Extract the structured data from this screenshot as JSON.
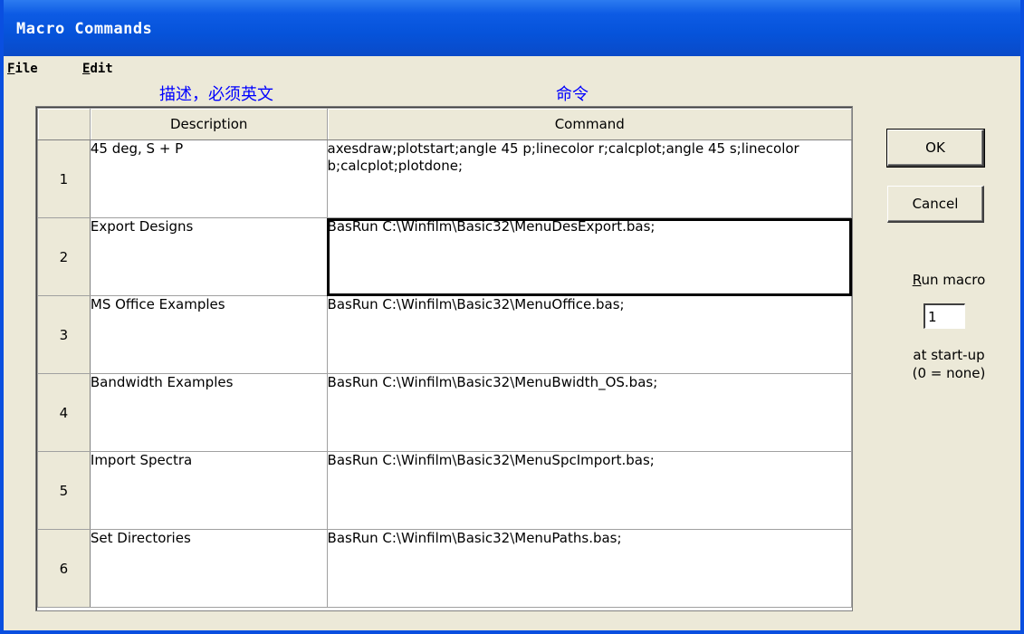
{
  "window": {
    "title": "Macro Commands"
  },
  "menu": [
    {
      "key": "F",
      "rest": "ile"
    },
    {
      "key": "E",
      "rest": "dit"
    }
  ],
  "annotations": {
    "description_note": "描述，必须英文",
    "command_note": "命令"
  },
  "grid": {
    "columns": [
      "Description",
      "Command"
    ],
    "rows": [
      {
        "num": "1",
        "description": "45 deg, S + P",
        "command": "axesdraw;plotstart;angle 45 p;linecolor r;calcplot;angle 45 s;linecolor b;calcplot;plotdone;"
      },
      {
        "num": "2",
        "description": "Export Designs",
        "command": "BasRun C:\\Winfilm\\Basic32\\MenuDesExport.bas;"
      },
      {
        "num": "3",
        "description": "MS Office Examples",
        "command": "BasRun C:\\Winfilm\\Basic32\\MenuOffice.bas;"
      },
      {
        "num": "4",
        "description": "Bandwidth Examples",
        "command": "BasRun C:\\Winfilm\\Basic32\\MenuBwidth_OS.bas;"
      },
      {
        "num": "5",
        "description": "Import Spectra",
        "command": "BasRun C:\\Winfilm\\Basic32\\MenuSpcImport.bas;"
      },
      {
        "num": "6",
        "description": "Set Directories",
        "command": "BasRun C:\\Winfilm\\Basic32\\MenuPaths.bas;"
      }
    ],
    "selected_row": 2
  },
  "buttons": {
    "ok": "OK",
    "cancel": "Cancel"
  },
  "run_macro": {
    "label_key": "R",
    "label_rest": "un macro",
    "value": "1",
    "note_line1": "at start-up",
    "note_line2": "(0 = none)"
  },
  "colors": {
    "title_bar": "#0A4AC8",
    "annotation": "#0000FF",
    "dialog_bg": "#ECE9D8"
  }
}
